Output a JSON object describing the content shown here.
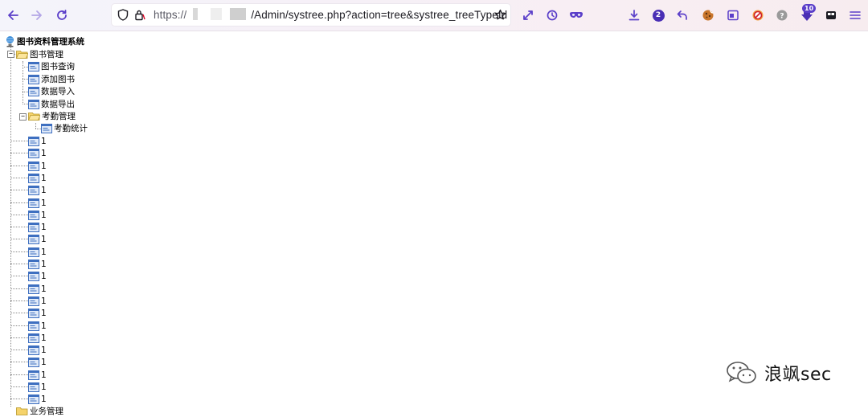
{
  "browser": {
    "url_prefix": "https://",
    "url_path": "/Admin/systree.php?action=tree&systree_treeTypeId",
    "extension_badges": {
      "notification_count": "2",
      "downloads_badge": "10"
    }
  },
  "tree": {
    "root_label": "图书资料管理系统",
    "book_management": {
      "label": "图书管理",
      "items": [
        "图书查询",
        "添加图书",
        "数据导入",
        "数据导出"
      ]
    },
    "attendance": {
      "label": "考勤管理",
      "items": [
        "考勤统计"
      ]
    },
    "injected_items": [
      "1",
      "1",
      "1",
      "1",
      "1",
      "1",
      "1",
      "1",
      "1",
      "1",
      "1",
      "1",
      "1",
      "1",
      "1",
      "1",
      "1",
      "1",
      "1",
      "1",
      "1",
      "1"
    ],
    "partial_bottom_label": "业务管理"
  },
  "watermark": {
    "text": "浪飒sec"
  },
  "colors": {
    "accent": "#5b3fc9",
    "folder": "#f5d36b",
    "page_icon": "#3e6fc0"
  }
}
